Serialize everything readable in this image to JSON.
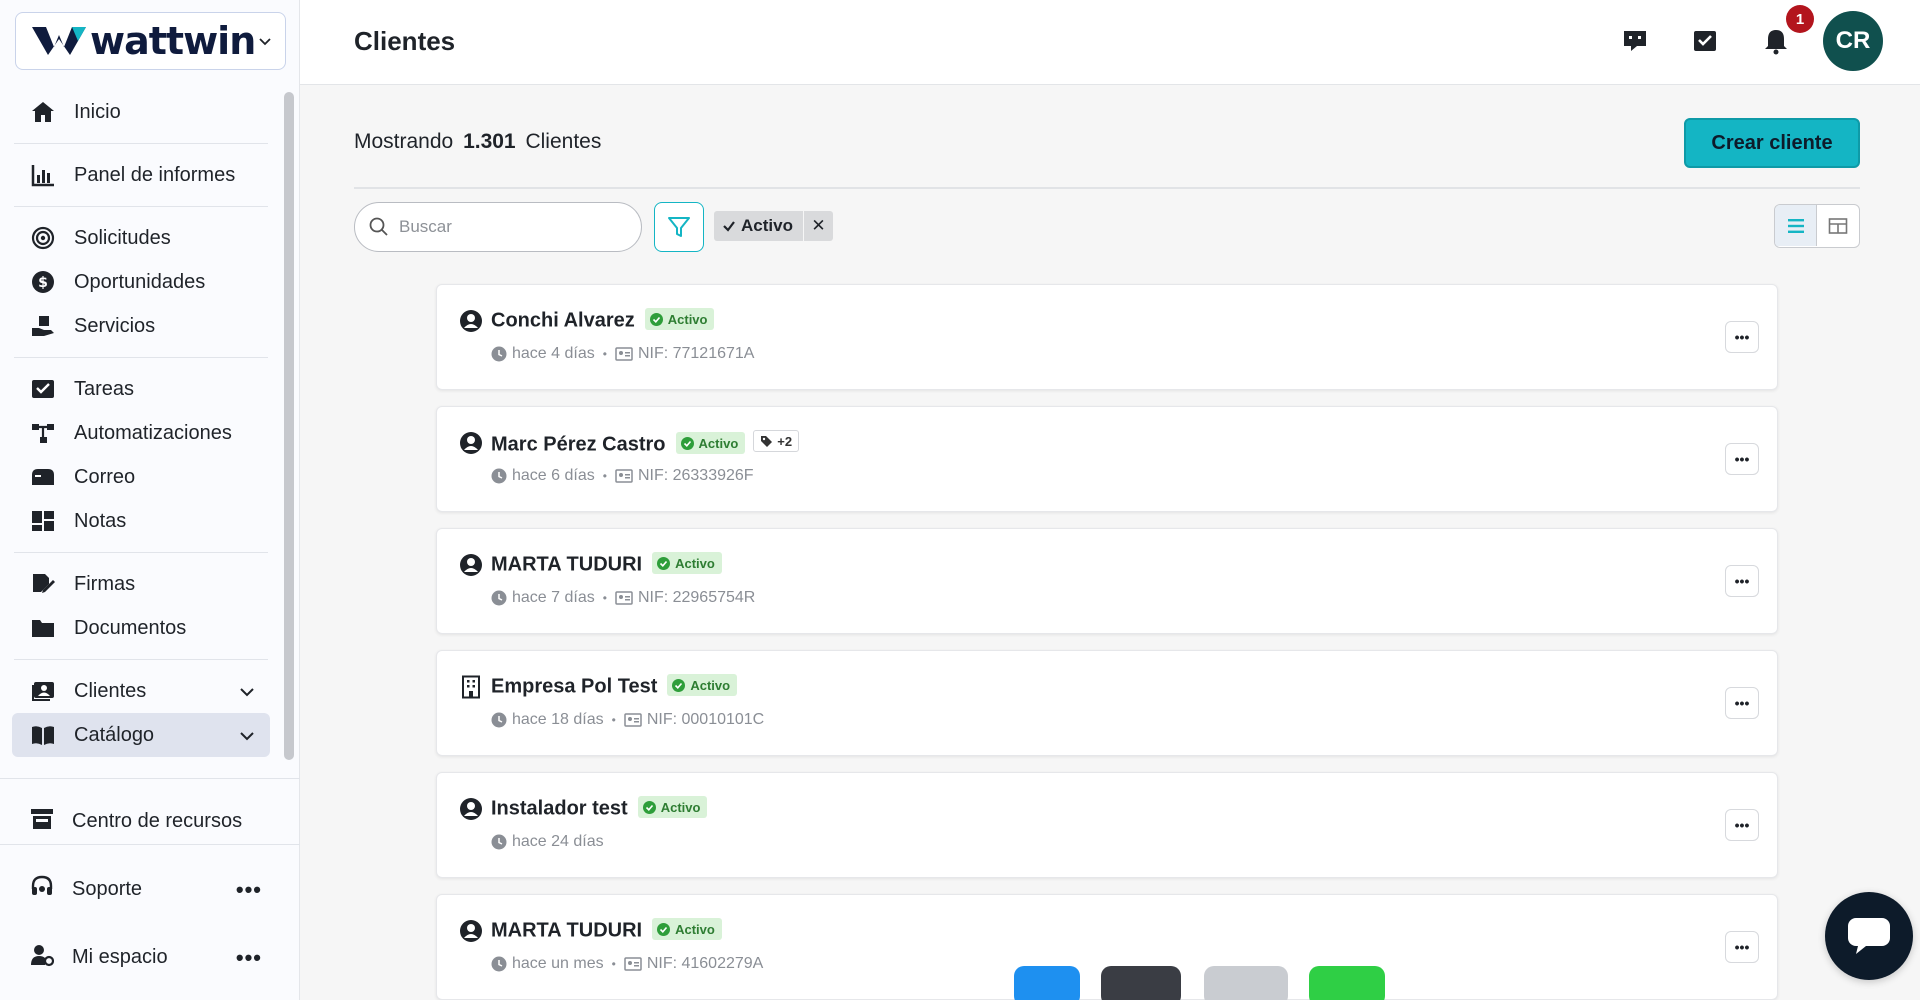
{
  "brand": {
    "name": "wattwin"
  },
  "sidebar": {
    "items": [
      {
        "id": "inicio",
        "label": "Inicio",
        "icon": "home-icon"
      },
      {
        "id": "panel",
        "label": "Panel de informes",
        "icon": "bar-chart-icon"
      },
      {
        "id": "solicitudes",
        "label": "Solicitudes",
        "icon": "target-icon"
      },
      {
        "id": "oportunidades",
        "label": "Oportunidades",
        "icon": "dollar-icon"
      },
      {
        "id": "servicios",
        "label": "Servicios",
        "icon": "hand-box-icon"
      },
      {
        "id": "tareas",
        "label": "Tareas",
        "icon": "task-check-icon"
      },
      {
        "id": "automatizaciones",
        "label": "Automatizaciones",
        "icon": "workflow-icon"
      },
      {
        "id": "correo",
        "label": "Correo",
        "icon": "mailbox-icon"
      },
      {
        "id": "notas",
        "label": "Notas",
        "icon": "notes-icon"
      },
      {
        "id": "firmas",
        "label": "Firmas",
        "icon": "signature-icon"
      },
      {
        "id": "documentos",
        "label": "Documentos",
        "icon": "folder-icon"
      },
      {
        "id": "clientes",
        "label": "Clientes",
        "icon": "contacts-icon"
      },
      {
        "id": "catalogo",
        "label": "Catálogo",
        "icon": "book-icon"
      }
    ],
    "resources": "Centro de recursos",
    "support": "Soporte",
    "myspace": "Mi espacio",
    "more": "•••"
  },
  "header": {
    "title": "Clientes",
    "notification_count": "1",
    "avatar_initials": "CR"
  },
  "main": {
    "showing_prefix": "Mostrando",
    "count": "1.301",
    "entity": "Clientes",
    "create_label": "Crear cliente",
    "search_placeholder": "Buscar",
    "filter_chip": "Activo",
    "filter_chip_remove": "✕"
  },
  "clients": [
    {
      "name": "Conchi Alvarez",
      "type": "person",
      "status": "Activo",
      "time": "hace 4 días",
      "nif": "NIF: 77121671A",
      "tags": ""
    },
    {
      "name": "Marc Pérez Castro",
      "type": "person",
      "status": "Activo",
      "time": "hace 6 días",
      "nif": "NIF: 26333926F",
      "tags": "+2"
    },
    {
      "name": "MARTA TUDURI",
      "type": "person",
      "status": "Activo",
      "time": "hace 7 días",
      "nif": "NIF: 22965754R",
      "tags": ""
    },
    {
      "name": "Empresa Pol Test",
      "type": "company",
      "status": "Activo",
      "time": "hace 18 días",
      "nif": "NIF: 00010101C",
      "tags": ""
    },
    {
      "name": "Instalador test",
      "type": "person",
      "status": "Activo",
      "time": "hace 24 días",
      "nif": "",
      "tags": ""
    },
    {
      "name": "MARTA TUDURI",
      "type": "person",
      "status": "Activo",
      "time": "hace un mes",
      "nif": "NIF: 41602279A",
      "tags": ""
    }
  ],
  "colors": {
    "accent": "#14b5c4",
    "status_bg": "#d9f2d8",
    "status_fg": "#2e7d32",
    "avatar": "#10504e",
    "badge": "#b3151d"
  }
}
